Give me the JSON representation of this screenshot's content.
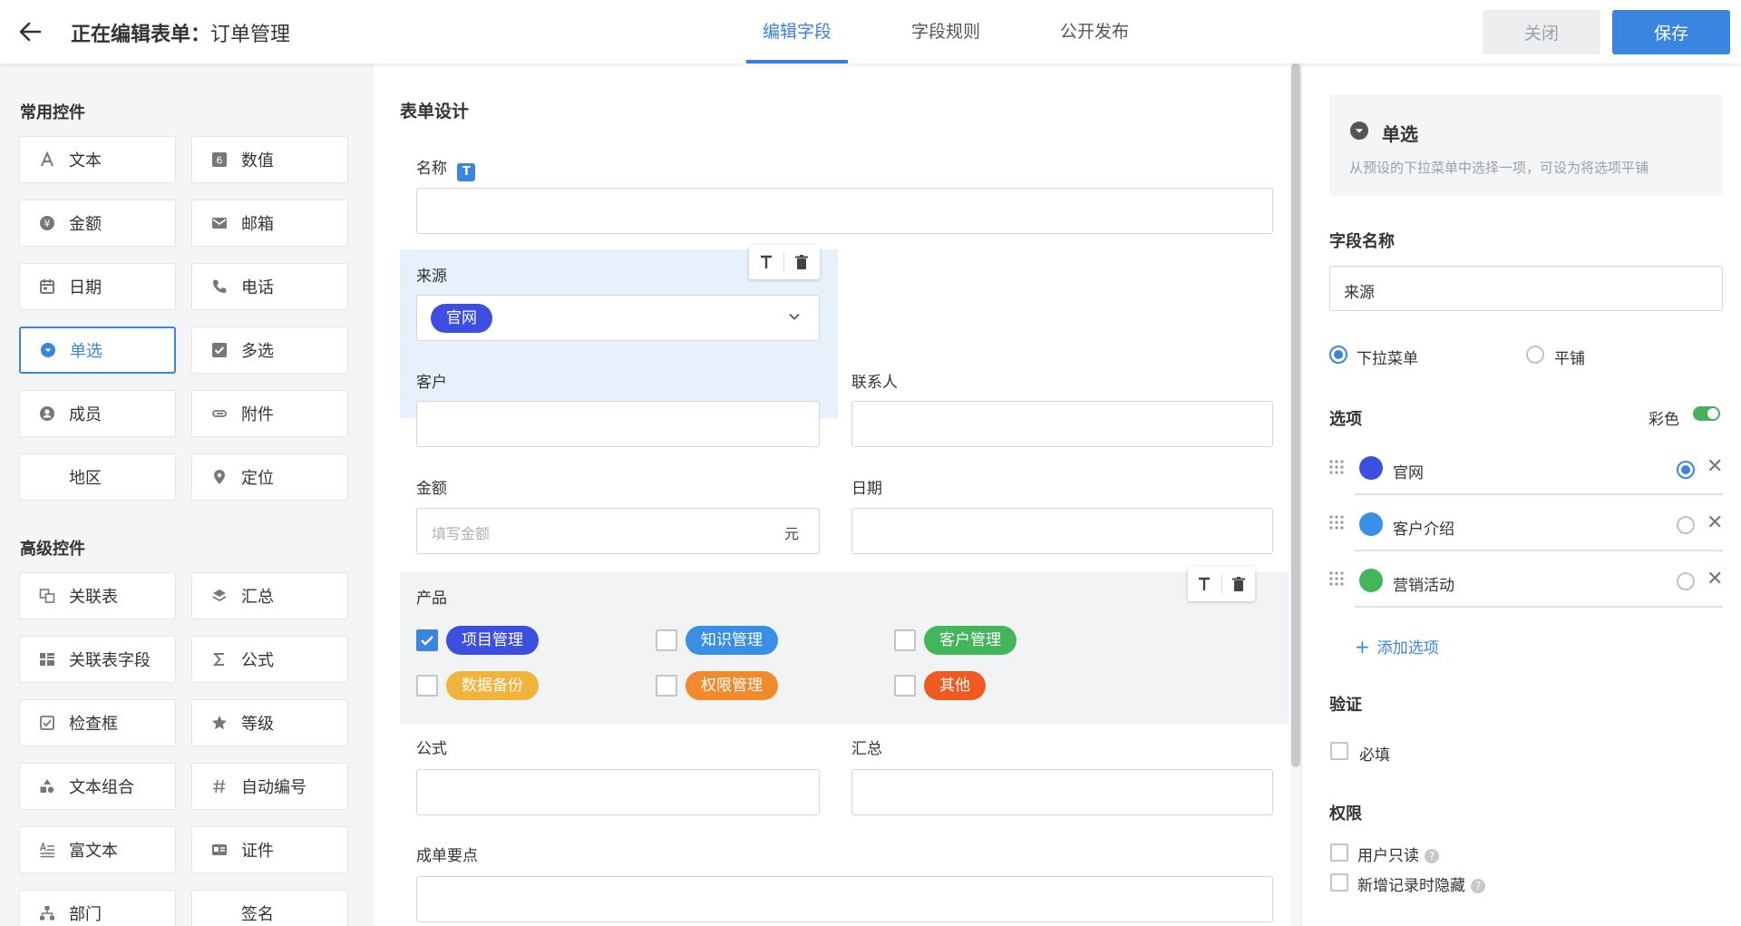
{
  "header": {
    "title_prefix": "正在编辑表单：",
    "title_name": "订单管理",
    "tabs": [
      "编辑字段",
      "字段规则",
      "公开发布"
    ],
    "close_label": "关闭",
    "save_label": "保存"
  },
  "palette": {
    "common_title": "常用控件",
    "common": [
      "文本",
      "数值",
      "金额",
      "邮箱",
      "日期",
      "电话",
      "单选",
      "多选",
      "成员",
      "附件",
      "地区",
      "定位"
    ],
    "advanced_title": "高级控件",
    "advanced": [
      "关联表",
      "汇总",
      "关联表字段",
      "公式",
      "检查框",
      "等级",
      "文本组合",
      "自动编号",
      "富文本",
      "证件",
      "部门",
      "签名"
    ],
    "selected": "单选"
  },
  "form": {
    "title": "表单设计",
    "name_label": "名称",
    "name_badge": "T",
    "source_label": "来源",
    "source_value": "官网",
    "customer_label": "客户",
    "contact_label": "联系人",
    "amount_label": "金额",
    "amount_placeholder": "填写金额",
    "amount_unit": "元",
    "date_label": "日期",
    "product_label": "产品",
    "products": [
      {
        "label": "项目管理",
        "color": "#3d4fe0",
        "checked": true
      },
      {
        "label": "知识管理",
        "color": "#3a8ee6",
        "checked": false
      },
      {
        "label": "客户管理",
        "color": "#43b55a",
        "checked": false
      },
      {
        "label": "数据备份",
        "color": "#f0b33b",
        "checked": false
      },
      {
        "label": "权限管理",
        "color": "#f08a2c",
        "checked": false
      },
      {
        "label": "其他",
        "color": "#ee5a22",
        "checked": false
      }
    ],
    "formula_label": "公式",
    "summary_label": "汇总",
    "points_label": "成单要点"
  },
  "props": {
    "type_name": "单选",
    "type_desc": "从预设的下拉菜单中选择一项，可设为将选项平铺",
    "field_name_label": "字段名称",
    "field_name_value": "来源",
    "mode_dropdown": "下拉菜单",
    "mode_tile": "平铺",
    "options_label": "选项",
    "color_label": "彩色",
    "options": [
      {
        "label": "官网",
        "color": "#3d4fe0",
        "default": true
      },
      {
        "label": "客户介绍",
        "color": "#3a8ee6",
        "default": false
      },
      {
        "label": "营销活动",
        "color": "#43b55a",
        "default": false
      }
    ],
    "add_option": "添加选项",
    "validation_label": "验证",
    "required_label": "必填",
    "permission_label": "权限",
    "readonly_label": "用户只读",
    "hide_on_new_label": "新增记录时隐藏",
    "accent_color": "#3a85e0"
  }
}
